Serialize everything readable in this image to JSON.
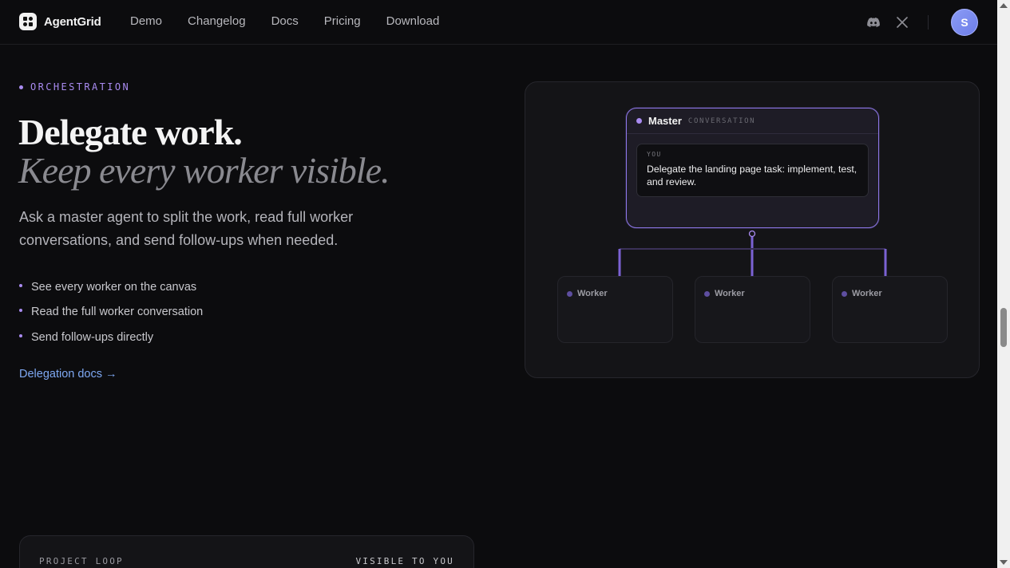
{
  "brand": {
    "name": "AgentGrid"
  },
  "nav": {
    "links": [
      "Demo",
      "Changelog",
      "Docs",
      "Pricing",
      "Download"
    ],
    "avatar_initial": "S"
  },
  "hero": {
    "eyebrow": "ORCHESTRATION",
    "title": "Delegate work.",
    "title_italic": "Keep every worker visible.",
    "lede": "Ask a master agent to split the work, read full worker conversations, and send follow-ups when needed.",
    "features": [
      "See every worker on the canvas",
      "Read the full worker conversation",
      "Send follow-ups directly"
    ],
    "link": "Delegation docs →"
  },
  "diagram": {
    "master_title": "Master",
    "master_tag": "CONVERSATION",
    "message_author": "YOU",
    "message_text": "Delegate the landing page task: implement, test, and review.",
    "workers": [
      "Worker",
      "Worker",
      "Worker"
    ]
  },
  "loop": {
    "left_label": "PROJECT LOOP",
    "right_label": "VISIBLE TO YOU"
  },
  "colors": {
    "accent": "#a98bf0",
    "link": "#7ea8f2",
    "background": "#0c0c0e"
  }
}
